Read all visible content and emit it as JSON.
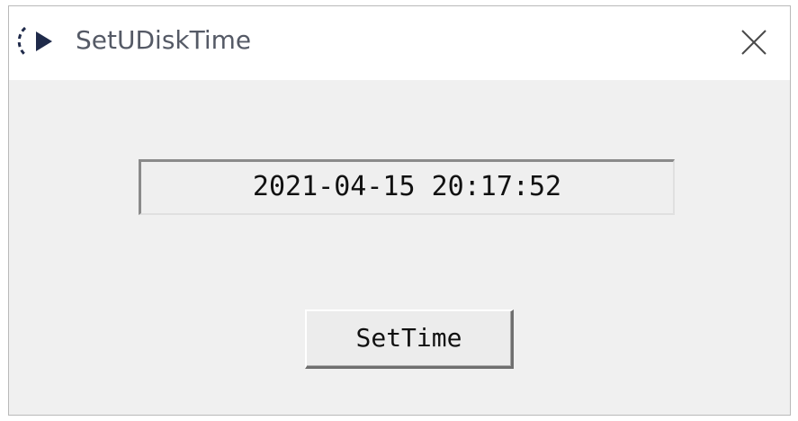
{
  "window": {
    "title": "SetUDiskTime",
    "app_icon": "crescent-arrow-app-icon",
    "close_icon": "close-icon"
  },
  "time_field": {
    "value": "2021-04-15 20:17:52"
  },
  "set_time_button": {
    "label": "SetTime"
  },
  "colors": {
    "title_text": "#555a66",
    "icon_navy": "#1f2a4a",
    "dialog_bg": "#f0f0f0"
  }
}
